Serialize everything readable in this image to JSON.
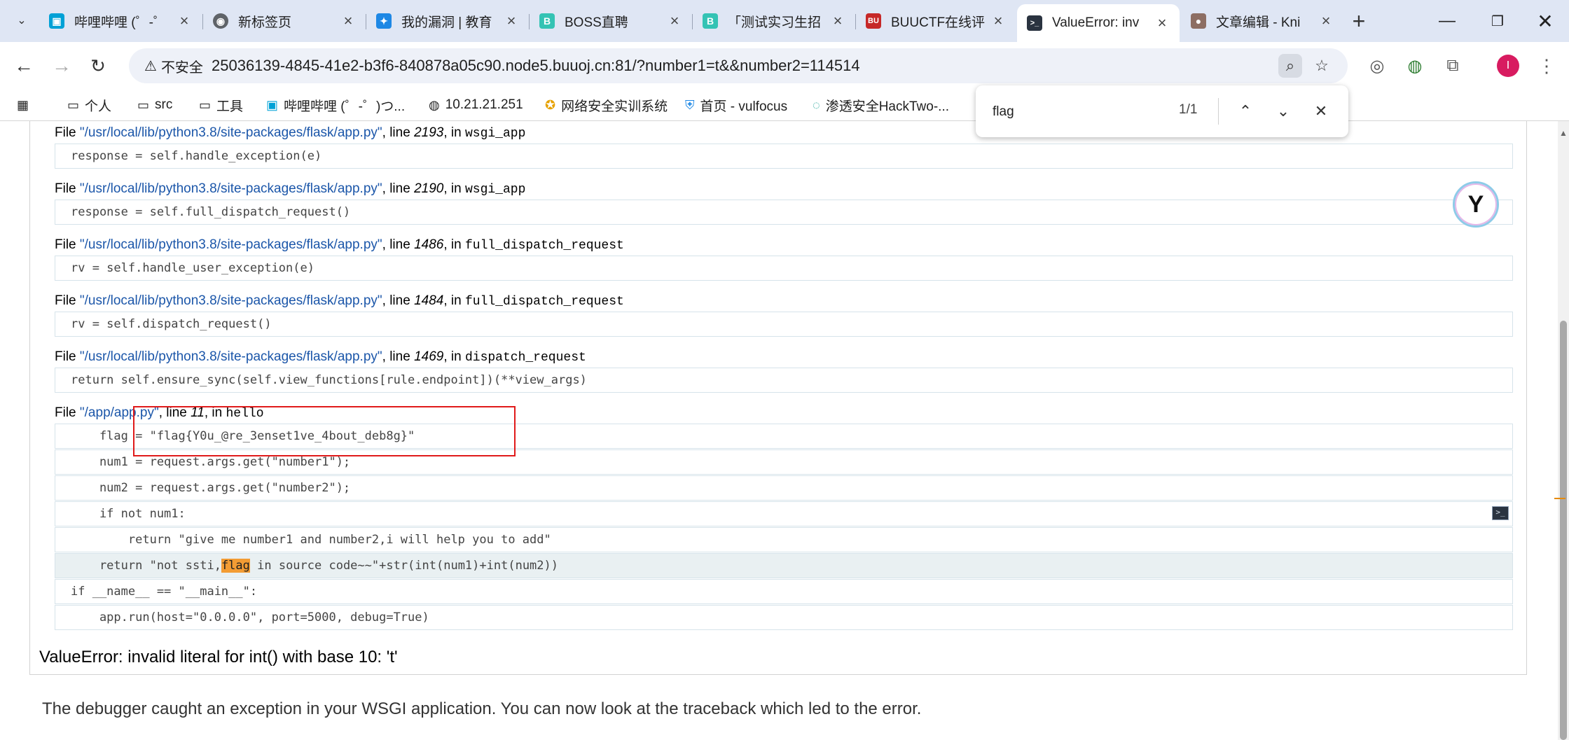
{
  "browser": {
    "tabs": [
      {
        "title": "哔哩哔哩 (゜-゜",
        "icon": "bilibili-icon",
        "color": "#00a1d6"
      },
      {
        "title": "新标签页",
        "icon": "chrome-icon",
        "color": "#5f6368"
      },
      {
        "title": "我的漏洞 | 教育",
        "icon": "bird-icon",
        "color": "#1e88e5"
      },
      {
        "title": "BOSS直聘",
        "icon": "boss-icon",
        "color": "#34c3b4"
      },
      {
        "title": "「测试实习生招",
        "icon": "boss-icon",
        "color": "#34c3b4"
      },
      {
        "title": "BUUCTF在线评",
        "icon": "buuctf-icon",
        "color": "#c62828"
      },
      {
        "title": "ValueError: inv",
        "icon": "terminal-icon",
        "color": "#2a3340"
      },
      {
        "title": "文章编辑 - Kni",
        "icon": "avatar-icon",
        "color": "#8d6e63"
      }
    ],
    "address": {
      "security_label": "不安全",
      "url": "25036139-4845-41e2-b3f6-840878a05c90.node5.buuoj.cn:81/?number1=t&&number2=114514"
    },
    "bookmarks": [
      {
        "label": "",
        "icon": "apps-grid-icon"
      },
      {
        "label": "个人",
        "icon": "folder-icon"
      },
      {
        "label": "src",
        "icon": "folder-icon"
      },
      {
        "label": "工具",
        "icon": "folder-icon"
      },
      {
        "label": "哔哩哔哩 (゜-゜)つ...",
        "icon": "bilibili-icon"
      },
      {
        "label": "10.21.21.251",
        "icon": "globe-icon"
      },
      {
        "label": "网络安全实训系统",
        "icon": "bookmark-icon"
      },
      {
        "label": "首页 - vulfocus",
        "icon": "bookmark-icon"
      },
      {
        "label": "渗透安全HackTwo-...",
        "icon": "bookmark-icon"
      }
    ],
    "find": {
      "query": "flag",
      "count": "1/1"
    }
  },
  "traceback": {
    "frames": [
      {
        "prefix": "File ",
        "file": "\"/usr/local/lib/python3.8/site-packages/flask/app.py\"",
        "mid": ", line ",
        "line": "2193",
        "in": ", in ",
        "func": "wsgi_app",
        "code": "response = self.handle_exception(e)"
      },
      {
        "prefix": "File ",
        "file": "\"/usr/local/lib/python3.8/site-packages/flask/app.py\"",
        "mid": ", line ",
        "line": "2190",
        "in": ", in ",
        "func": "wsgi_app",
        "code": "response = self.full_dispatch_request()"
      },
      {
        "prefix": "File ",
        "file": "\"/usr/local/lib/python3.8/site-packages/flask/app.py\"",
        "mid": ", line ",
        "line": "1486",
        "in": ", in ",
        "func": "full_dispatch_request",
        "code": "rv = self.handle_user_exception(e)"
      },
      {
        "prefix": "File ",
        "file": "\"/usr/local/lib/python3.8/site-packages/flask/app.py\"",
        "mid": ", line ",
        "line": "1484",
        "in": ", in ",
        "func": "full_dispatch_request",
        "code": "rv = self.dispatch_request()"
      },
      {
        "prefix": "File ",
        "file": "\"/usr/local/lib/python3.8/site-packages/flask/app.py\"",
        "mid": ", line ",
        "line": "1469",
        "in": ", in ",
        "func": "dispatch_request",
        "code": "return self.ensure_sync(self.view_functions[rule.endpoint])(**view_args)"
      }
    ],
    "last_frame": {
      "prefix": "File ",
      "file": "\"/app/app.py\"",
      "mid": ", line ",
      "line": "11",
      "in": ", in ",
      "func": "hello",
      "lines": [
        "    flag = \"flag{Y0u_@re_3enset1ve_4bout_deb8g}\"",
        "    num1 = request.args.get(\"number1\");",
        "    num2 = request.args.get(\"number2\");",
        "    if not num1:",
        "        return \"give me number1 and number2,i will help you to add\"",
        "    return \"not ssti,",
        "if __name__ == \"__main__\":",
        "    app.run(host=\"0.0.0.0\", port=5000, debug=True)"
      ],
      "highlight_word": "flag",
      "highlight_rest": " in source code~~\"+str(int(num1)+int(num2))"
    },
    "error": "ValueError: invalid literal for int() with base 10: 't'",
    "explanation": "The debugger caught an exception in your WSGI application. You can now look at the traceback which led to the error."
  }
}
